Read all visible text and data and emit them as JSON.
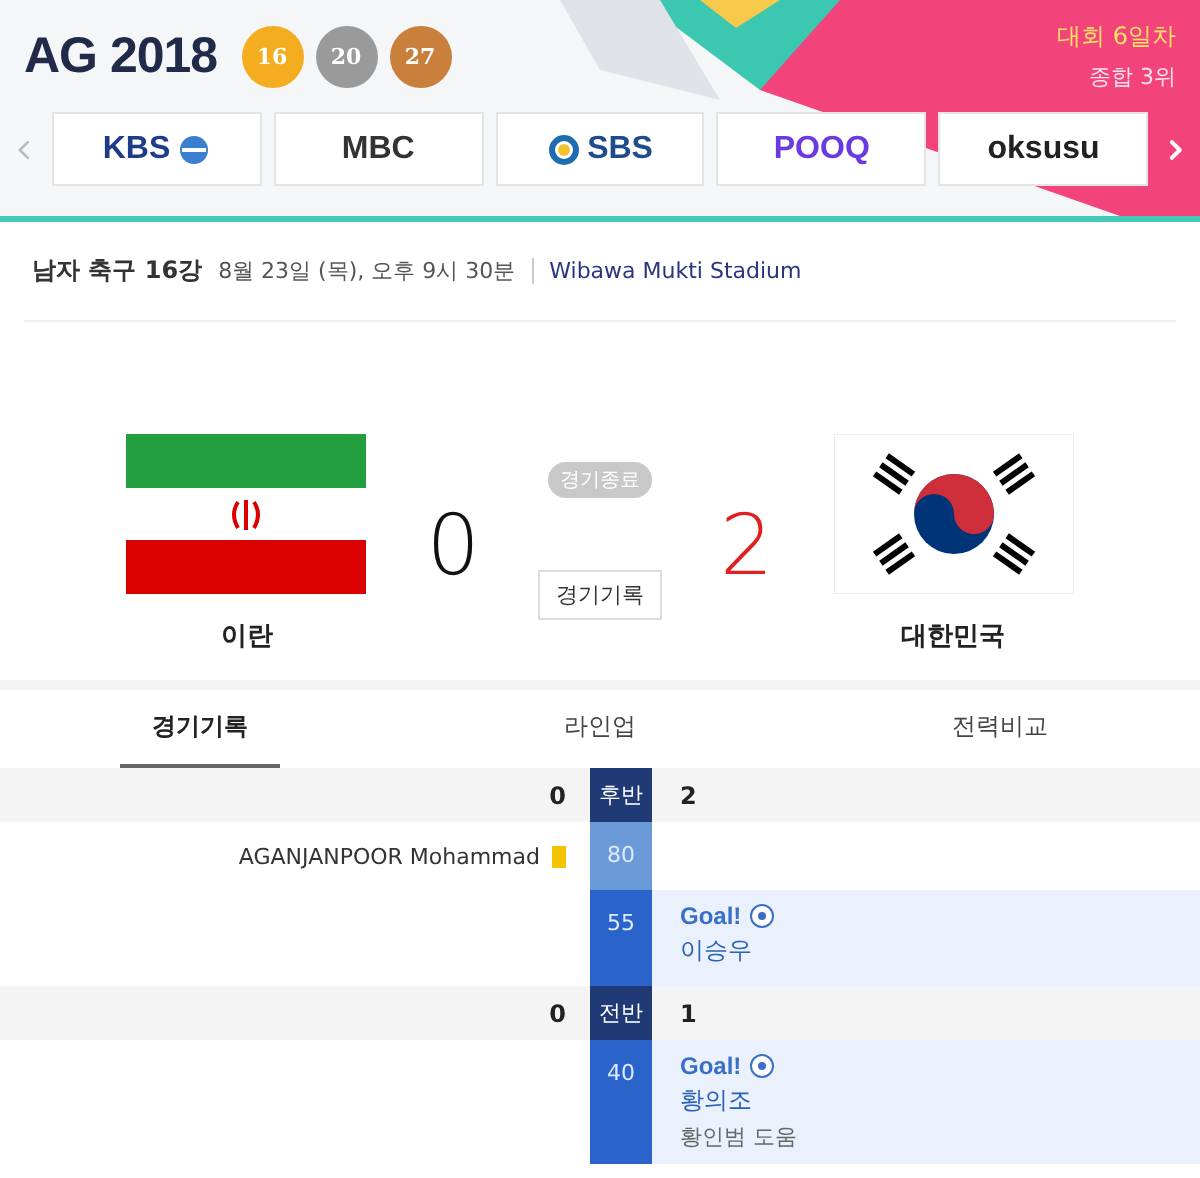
{
  "header": {
    "logo": "AG 2018",
    "medals": [
      {
        "kind": "gold",
        "count": "16"
      },
      {
        "kind": "silver",
        "count": "20"
      },
      {
        "kind": "bronze",
        "count": "27"
      }
    ],
    "day": "대회 6일차",
    "rank": "종합 3위"
  },
  "broadcasters": [
    {
      "name": "KBS",
      "kind": "kbs"
    },
    {
      "name": "MBC",
      "kind": "mbc"
    },
    {
      "name": "SBS",
      "kind": "sbs"
    },
    {
      "name": "POOQ",
      "kind": "pooq"
    },
    {
      "name": "oksusu",
      "kind": "oksusu"
    }
  ],
  "match": {
    "title": "남자 축구 16강",
    "date": "8월 23일 (목), 오후 9시 30분",
    "venue": "Wibawa Mukti Stadium",
    "status": "경기종료",
    "record_button": "경기기록"
  },
  "home": {
    "name": "이란",
    "score": "0",
    "kind": "iran",
    "winner": false
  },
  "away": {
    "name": "대한민국",
    "score": "2",
    "kind": "korea",
    "winner": true
  },
  "tabs": [
    {
      "label": "경기기록",
      "selected": true
    },
    {
      "label": "라인업",
      "selected": false
    },
    {
      "label": "전력비교",
      "selected": false
    }
  ],
  "timeline": [
    {
      "label": "후반",
      "home": "0",
      "away": "2",
      "events": [
        {
          "minute": "80",
          "home": {
            "kind": "card",
            "player": "AGANJANPOOR Mohammad"
          }
        },
        {
          "minute": "55",
          "away": {
            "kind": "goal",
            "title": "Goal!",
            "player": "이승우"
          }
        }
      ]
    },
    {
      "label": "전반",
      "home": "0",
      "away": "1",
      "events": [
        {
          "minute": "40",
          "away": {
            "kind": "goal",
            "title": "Goal!",
            "player": "황의조",
            "assist": "황인범 도움"
          }
        }
      ]
    }
  ]
}
